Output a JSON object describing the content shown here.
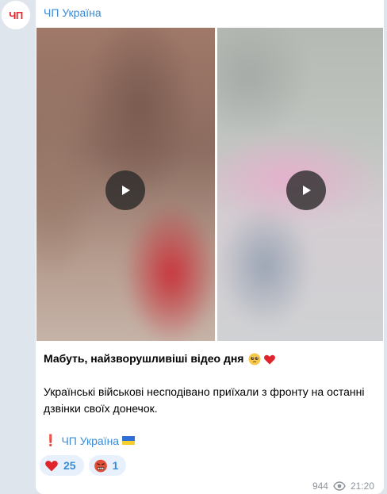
{
  "channel": {
    "name": "ЧП Україна",
    "avatar_text": "ЧП"
  },
  "post": {
    "title": "Мабуть, найзворушливіші відео дня",
    "title_emojis": [
      "pleading-face-icon",
      "red-heart-icon"
    ],
    "body": "Українські військові несподівано приїхали з фронту на останні дзвінки своїх донечок.",
    "signature": "ЧП Україна",
    "signature_prefix_icon": "exclamation-icon",
    "signature_suffix_icon": "ukraine-flag-icon"
  },
  "reactions": [
    {
      "icon": "red-heart-icon",
      "count": "25"
    },
    {
      "icon": "angry-face-icon",
      "count": "1"
    }
  ],
  "meta": {
    "views": "944",
    "time": "21:20"
  },
  "colors": {
    "link": "#3a8bd5",
    "background": "#dfe5ec",
    "bubble": "#ffffff"
  }
}
